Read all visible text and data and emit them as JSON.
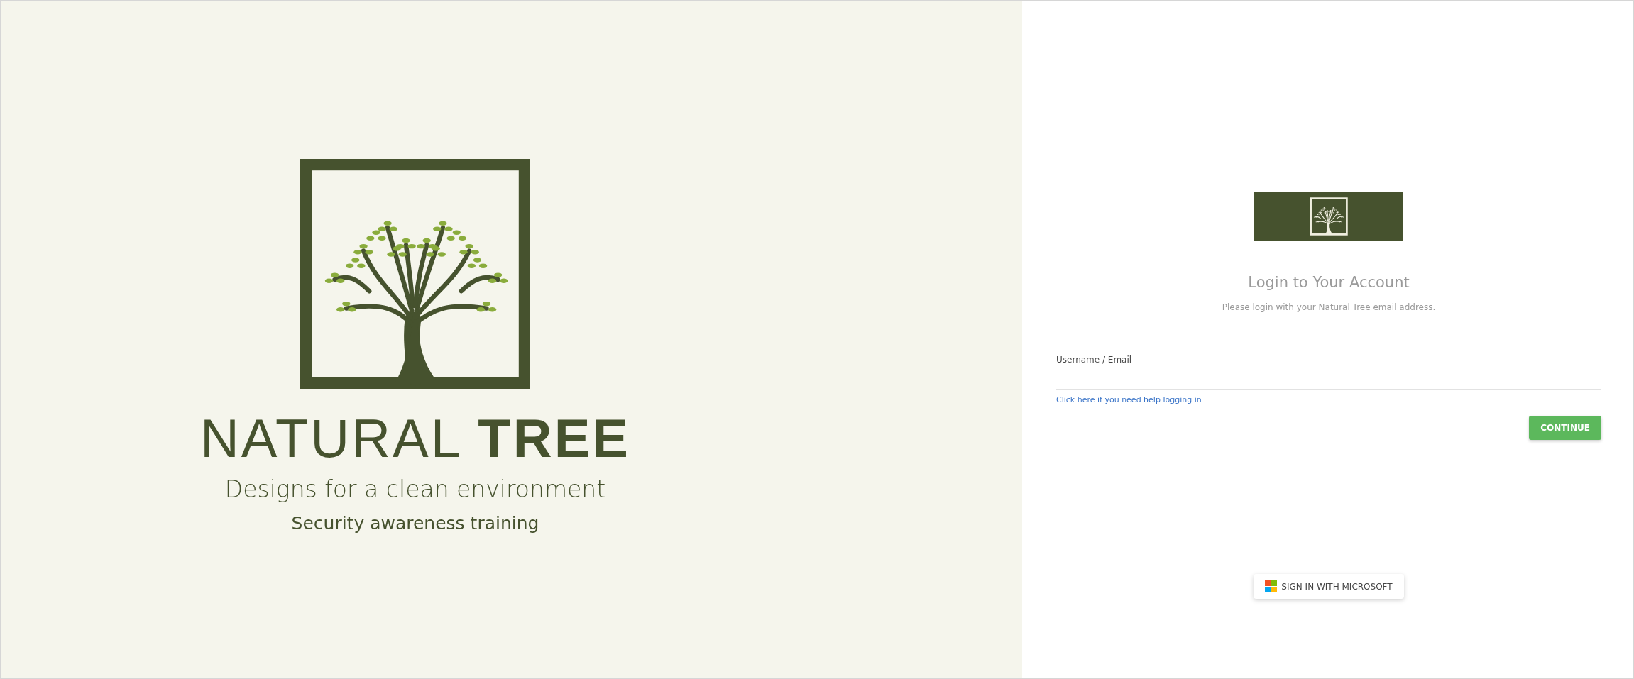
{
  "brand": {
    "name": "NATURAL **TREE**",
    "tagline": "Designs for a clean environment",
    "subtitle": "Security awareness training"
  },
  "login": {
    "title": "Login to Your Account",
    "subtitle": "Please login with your Natural Tree email address.",
    "field": {
      "label": "Username / Email"
    },
    "help_link": "Click here if you need help logging in",
    "continue_button": "CONTINUE",
    "microsoft_button": "SIGN IN WITH MICROSOFT"
  }
}
